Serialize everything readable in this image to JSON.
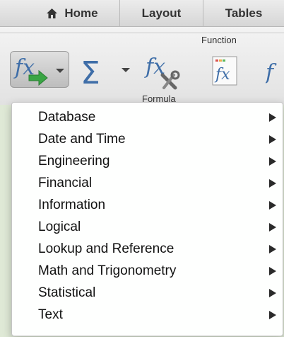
{
  "ribbon": {
    "tabs": [
      {
        "label": "Home",
        "icon": "home-icon"
      },
      {
        "label": "Layout"
      },
      {
        "label": "Tables"
      }
    ],
    "group_title": "Function",
    "buttons": {
      "insert_function": {
        "icon": "insert-function-icon"
      },
      "autosum": {
        "icon": "sigma-icon"
      },
      "formula_builder": {
        "icon": "formula-builder-icon",
        "label": "Formula"
      },
      "fx_box": {
        "icon": "fx-box-icon"
      }
    }
  },
  "menu": {
    "items": [
      {
        "label": "Database"
      },
      {
        "label": "Date and Time"
      },
      {
        "label": "Engineering"
      },
      {
        "label": "Financial"
      },
      {
        "label": "Information"
      },
      {
        "label": "Logical"
      },
      {
        "label": "Lookup and Reference"
      },
      {
        "label": "Math and Trigonometry"
      },
      {
        "label": "Statistical"
      },
      {
        "label": "Text"
      }
    ]
  },
  "colors": {
    "accent_green": "#3aa544",
    "fx_blue": "#3f6ea8",
    "menu_text": "#111111"
  }
}
